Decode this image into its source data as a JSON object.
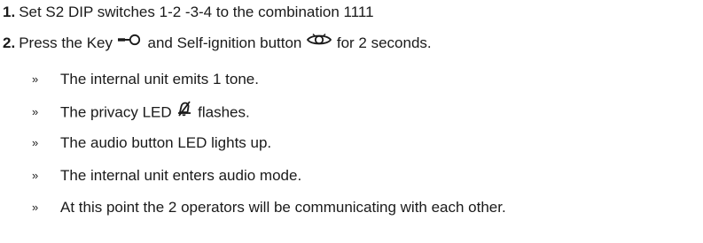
{
  "steps": [
    {
      "number": "1.",
      "text": "Set S2 DIP switches 1-2 -3-4 to the combination 1111"
    },
    {
      "number": "2.",
      "text_before_key": "Press the Key",
      "text_before_ignition": "and Self-ignition button",
      "text_after": "for 2 seconds.",
      "icons": [
        "key-icon",
        "eye-icon"
      ]
    }
  ],
  "bullet_marker": "»",
  "bullets": [
    {
      "text": "The internal unit emits 1 tone."
    },
    {
      "text_before": "The privacy LED",
      "icon": "bell-off-icon",
      "text_after": "flashes."
    },
    {
      "text": "The audio button LED lights up."
    },
    {
      "text": "The internal unit enters audio mode."
    },
    {
      "text": "At this point the 2 operators will be communicating with each other."
    }
  ]
}
